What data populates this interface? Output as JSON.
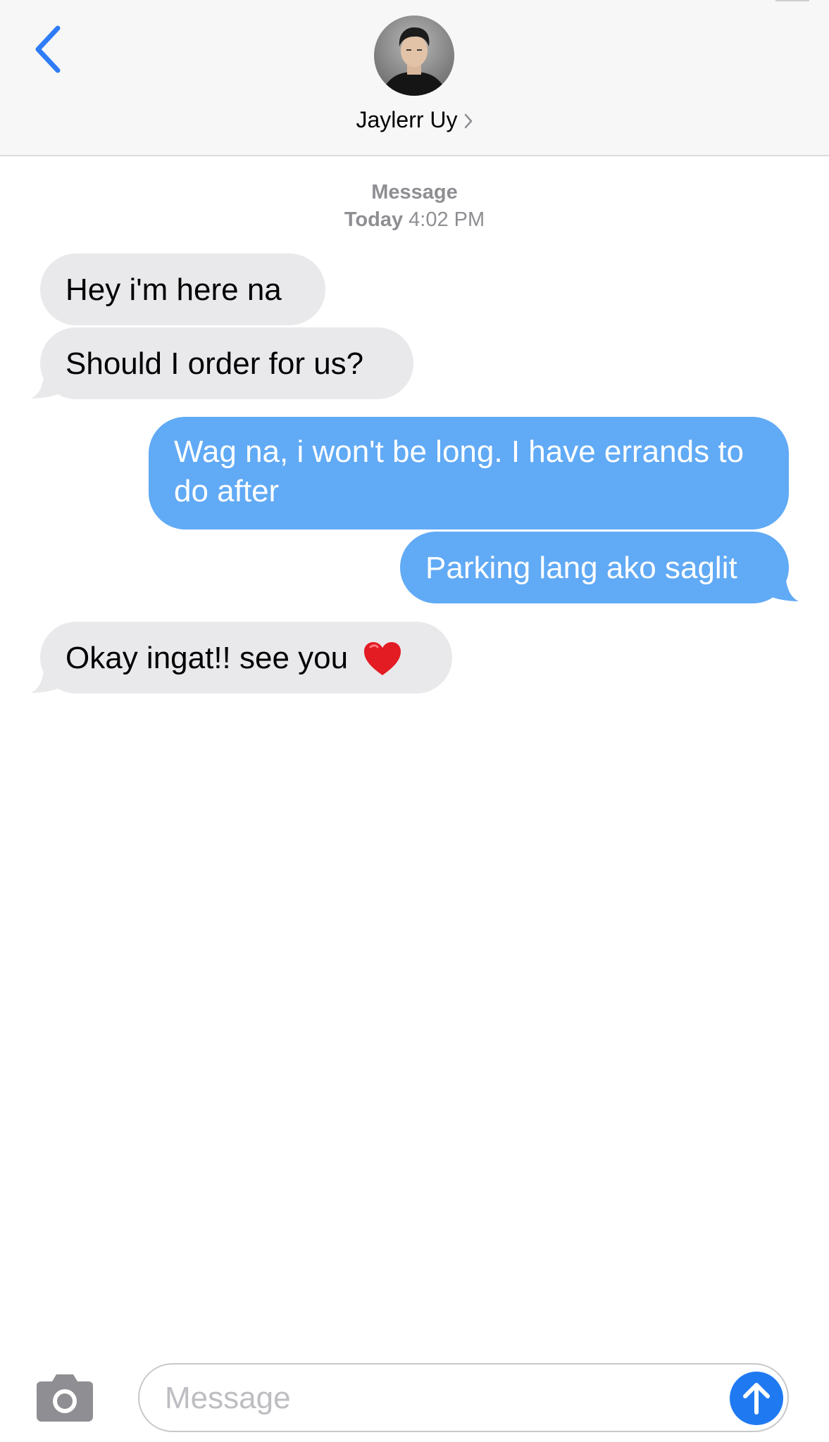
{
  "header": {
    "contact_name": "Jaylerr Uy",
    "back_icon": "chevron-left-icon",
    "details_icon": "chevron-right-icon"
  },
  "timestamp": {
    "label": "Message",
    "day": "Today",
    "time": "4:02 PM"
  },
  "messages": [
    {
      "direction": "incoming",
      "text": "Hey i'm here na"
    },
    {
      "direction": "incoming",
      "text": "Should I order for us?"
    },
    {
      "direction": "outgoing",
      "text": "Wag na, i won't be long. I have errands to do after"
    },
    {
      "direction": "outgoing",
      "text": "Parking lang ako saglit"
    },
    {
      "direction": "incoming",
      "text": "Okay ingat!! see you"
    }
  ],
  "composer": {
    "placeholder": "Message",
    "camera_icon": "camera-icon",
    "send_icon": "arrow-up-icon"
  },
  "colors": {
    "accent": "#1f7af2",
    "outgoing_bubble": "#61aaf5",
    "incoming_bubble": "#e9e9eb",
    "header_bg": "#f7f7f7",
    "timestamp_text": "#8e8e93"
  }
}
